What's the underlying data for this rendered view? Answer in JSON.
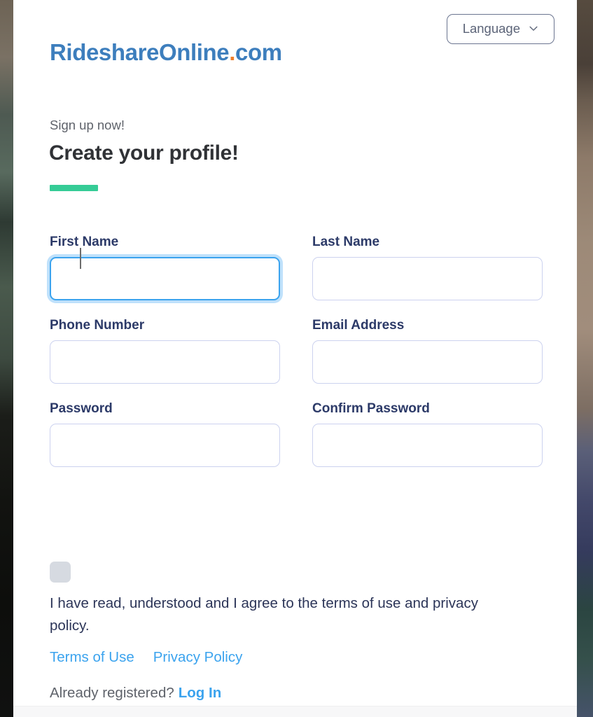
{
  "brand": {
    "logo_text_blue": "RideshareOnline",
    "logo_dot": ".",
    "logo_text_tld": "com",
    "logo_blue": "#3d7ebd",
    "logo_orange": "#ef7e2a"
  },
  "header": {
    "language_label": "Language",
    "language_icon": "chevron-down-icon"
  },
  "intro": {
    "eyebrow": "Sign up now!",
    "title": "Create your profile!",
    "accent_color": "#35cc96"
  },
  "form": {
    "rows": [
      [
        {
          "label": "First Name",
          "value": "",
          "placeholder": "",
          "focused": true
        },
        {
          "label": "Last Name",
          "value": "",
          "placeholder": "",
          "focused": false
        }
      ],
      [
        {
          "label": "Phone Number",
          "value": "",
          "placeholder": "",
          "focused": false
        },
        {
          "label": "Email Address",
          "value": "",
          "placeholder": "",
          "focused": false
        }
      ],
      [
        {
          "label": "Password",
          "value": "",
          "placeholder": "",
          "focused": false
        },
        {
          "label": "Confirm Password",
          "value": "",
          "placeholder": "",
          "focused": false
        }
      ]
    ],
    "input_border_color": "#ccd2ef",
    "focus_border_color": "#3ba3ee",
    "label_color": "#2c3a68"
  },
  "terms": {
    "checkbox_checked": false,
    "checkbox_color": "#d6dae1",
    "agreement_text": "I have read, understood and I agree to the terms of use and privacy policy.",
    "links": [
      {
        "label": "Terms of Use"
      },
      {
        "label": "Privacy Policy"
      }
    ],
    "link_color": "#3ba3ee"
  },
  "footer": {
    "already_registered_text": "Already registered?",
    "login_label": "Log In"
  }
}
